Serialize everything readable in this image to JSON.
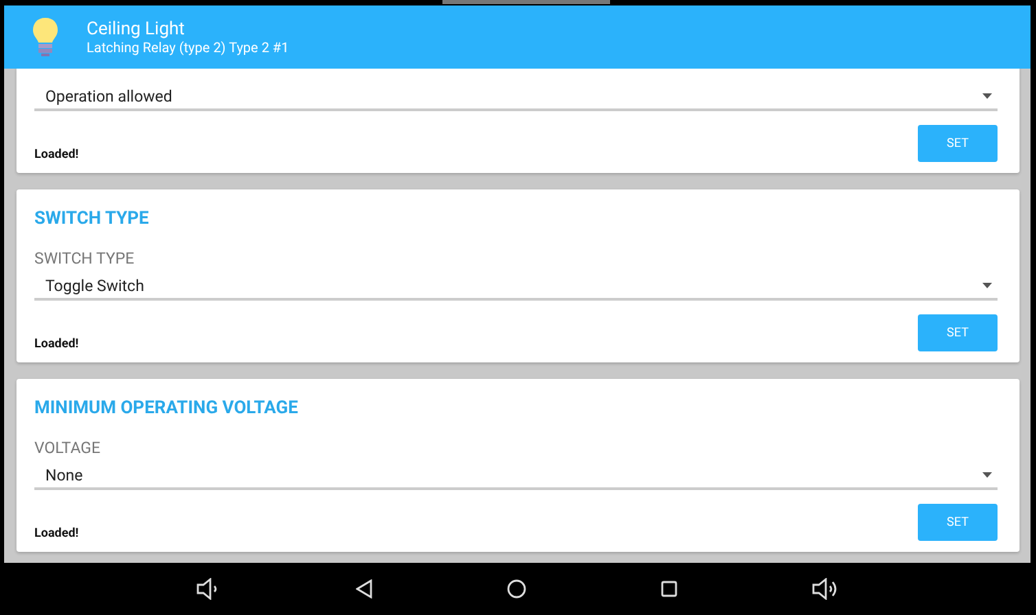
{
  "app_bar": {
    "title": "Ceiling Light",
    "subtitle": "Latching Relay (type 2) Type 2 #1"
  },
  "cards": [
    {
      "value": "Operation allowed",
      "button": "SET",
      "status": "Loaded!"
    },
    {
      "title": "SWITCH TYPE",
      "field_label": "SWITCH TYPE",
      "value": "Toggle Switch",
      "button": "SET",
      "status": "Loaded!"
    },
    {
      "title": "MINIMUM OPERATING VOLTAGE",
      "field_label": "VOLTAGE",
      "value": "None",
      "button": "SET",
      "status": "Loaded!"
    }
  ],
  "nav_bar": [
    {
      "kind": "volume-down"
    },
    {
      "kind": "back"
    },
    {
      "kind": "home"
    },
    {
      "kind": "recents"
    },
    {
      "kind": "volume-up"
    }
  ]
}
